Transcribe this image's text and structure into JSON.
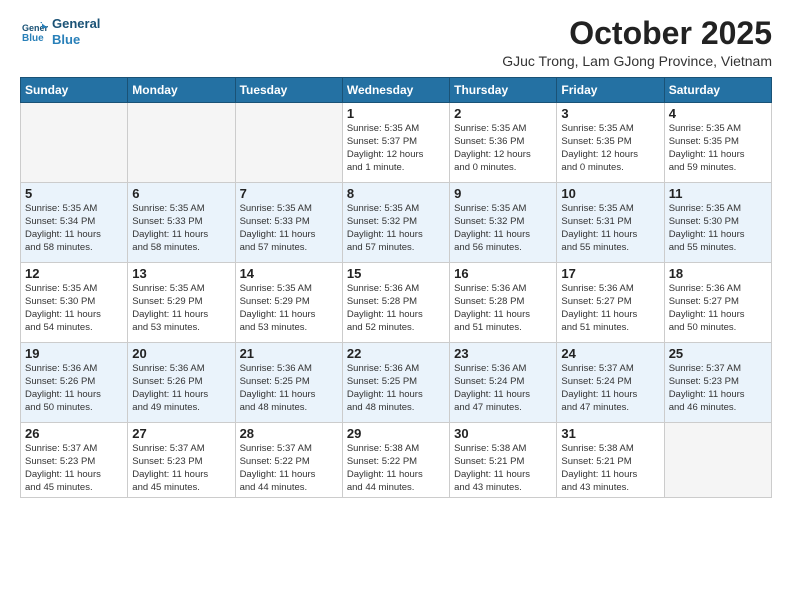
{
  "header": {
    "logo_line1": "General",
    "logo_line2": "Blue",
    "month": "October 2025",
    "location": "GJuc Trong, Lam GJong Province, Vietnam"
  },
  "days_of_week": [
    "Sunday",
    "Monday",
    "Tuesday",
    "Wednesday",
    "Thursday",
    "Friday",
    "Saturday"
  ],
  "weeks": [
    [
      {
        "day": "",
        "info": ""
      },
      {
        "day": "",
        "info": ""
      },
      {
        "day": "",
        "info": ""
      },
      {
        "day": "1",
        "info": "Sunrise: 5:35 AM\nSunset: 5:37 PM\nDaylight: 12 hours\nand 1 minute."
      },
      {
        "day": "2",
        "info": "Sunrise: 5:35 AM\nSunset: 5:36 PM\nDaylight: 12 hours\nand 0 minutes."
      },
      {
        "day": "3",
        "info": "Sunrise: 5:35 AM\nSunset: 5:35 PM\nDaylight: 12 hours\nand 0 minutes."
      },
      {
        "day": "4",
        "info": "Sunrise: 5:35 AM\nSunset: 5:35 PM\nDaylight: 11 hours\nand 59 minutes."
      }
    ],
    [
      {
        "day": "5",
        "info": "Sunrise: 5:35 AM\nSunset: 5:34 PM\nDaylight: 11 hours\nand 58 minutes."
      },
      {
        "day": "6",
        "info": "Sunrise: 5:35 AM\nSunset: 5:33 PM\nDaylight: 11 hours\nand 58 minutes."
      },
      {
        "day": "7",
        "info": "Sunrise: 5:35 AM\nSunset: 5:33 PM\nDaylight: 11 hours\nand 57 minutes."
      },
      {
        "day": "8",
        "info": "Sunrise: 5:35 AM\nSunset: 5:32 PM\nDaylight: 11 hours\nand 57 minutes."
      },
      {
        "day": "9",
        "info": "Sunrise: 5:35 AM\nSunset: 5:32 PM\nDaylight: 11 hours\nand 56 minutes."
      },
      {
        "day": "10",
        "info": "Sunrise: 5:35 AM\nSunset: 5:31 PM\nDaylight: 11 hours\nand 55 minutes."
      },
      {
        "day": "11",
        "info": "Sunrise: 5:35 AM\nSunset: 5:30 PM\nDaylight: 11 hours\nand 55 minutes."
      }
    ],
    [
      {
        "day": "12",
        "info": "Sunrise: 5:35 AM\nSunset: 5:30 PM\nDaylight: 11 hours\nand 54 minutes."
      },
      {
        "day": "13",
        "info": "Sunrise: 5:35 AM\nSunset: 5:29 PM\nDaylight: 11 hours\nand 53 minutes."
      },
      {
        "day": "14",
        "info": "Sunrise: 5:35 AM\nSunset: 5:29 PM\nDaylight: 11 hours\nand 53 minutes."
      },
      {
        "day": "15",
        "info": "Sunrise: 5:36 AM\nSunset: 5:28 PM\nDaylight: 11 hours\nand 52 minutes."
      },
      {
        "day": "16",
        "info": "Sunrise: 5:36 AM\nSunset: 5:28 PM\nDaylight: 11 hours\nand 51 minutes."
      },
      {
        "day": "17",
        "info": "Sunrise: 5:36 AM\nSunset: 5:27 PM\nDaylight: 11 hours\nand 51 minutes."
      },
      {
        "day": "18",
        "info": "Sunrise: 5:36 AM\nSunset: 5:27 PM\nDaylight: 11 hours\nand 50 minutes."
      }
    ],
    [
      {
        "day": "19",
        "info": "Sunrise: 5:36 AM\nSunset: 5:26 PM\nDaylight: 11 hours\nand 50 minutes."
      },
      {
        "day": "20",
        "info": "Sunrise: 5:36 AM\nSunset: 5:26 PM\nDaylight: 11 hours\nand 49 minutes."
      },
      {
        "day": "21",
        "info": "Sunrise: 5:36 AM\nSunset: 5:25 PM\nDaylight: 11 hours\nand 48 minutes."
      },
      {
        "day": "22",
        "info": "Sunrise: 5:36 AM\nSunset: 5:25 PM\nDaylight: 11 hours\nand 48 minutes."
      },
      {
        "day": "23",
        "info": "Sunrise: 5:36 AM\nSunset: 5:24 PM\nDaylight: 11 hours\nand 47 minutes."
      },
      {
        "day": "24",
        "info": "Sunrise: 5:37 AM\nSunset: 5:24 PM\nDaylight: 11 hours\nand 47 minutes."
      },
      {
        "day": "25",
        "info": "Sunrise: 5:37 AM\nSunset: 5:23 PM\nDaylight: 11 hours\nand 46 minutes."
      }
    ],
    [
      {
        "day": "26",
        "info": "Sunrise: 5:37 AM\nSunset: 5:23 PM\nDaylight: 11 hours\nand 45 minutes."
      },
      {
        "day": "27",
        "info": "Sunrise: 5:37 AM\nSunset: 5:23 PM\nDaylight: 11 hours\nand 45 minutes."
      },
      {
        "day": "28",
        "info": "Sunrise: 5:37 AM\nSunset: 5:22 PM\nDaylight: 11 hours\nand 44 minutes."
      },
      {
        "day": "29",
        "info": "Sunrise: 5:38 AM\nSunset: 5:22 PM\nDaylight: 11 hours\nand 44 minutes."
      },
      {
        "day": "30",
        "info": "Sunrise: 5:38 AM\nSunset: 5:21 PM\nDaylight: 11 hours\nand 43 minutes."
      },
      {
        "day": "31",
        "info": "Sunrise: 5:38 AM\nSunset: 5:21 PM\nDaylight: 11 hours\nand 43 minutes."
      },
      {
        "day": "",
        "info": ""
      }
    ]
  ]
}
